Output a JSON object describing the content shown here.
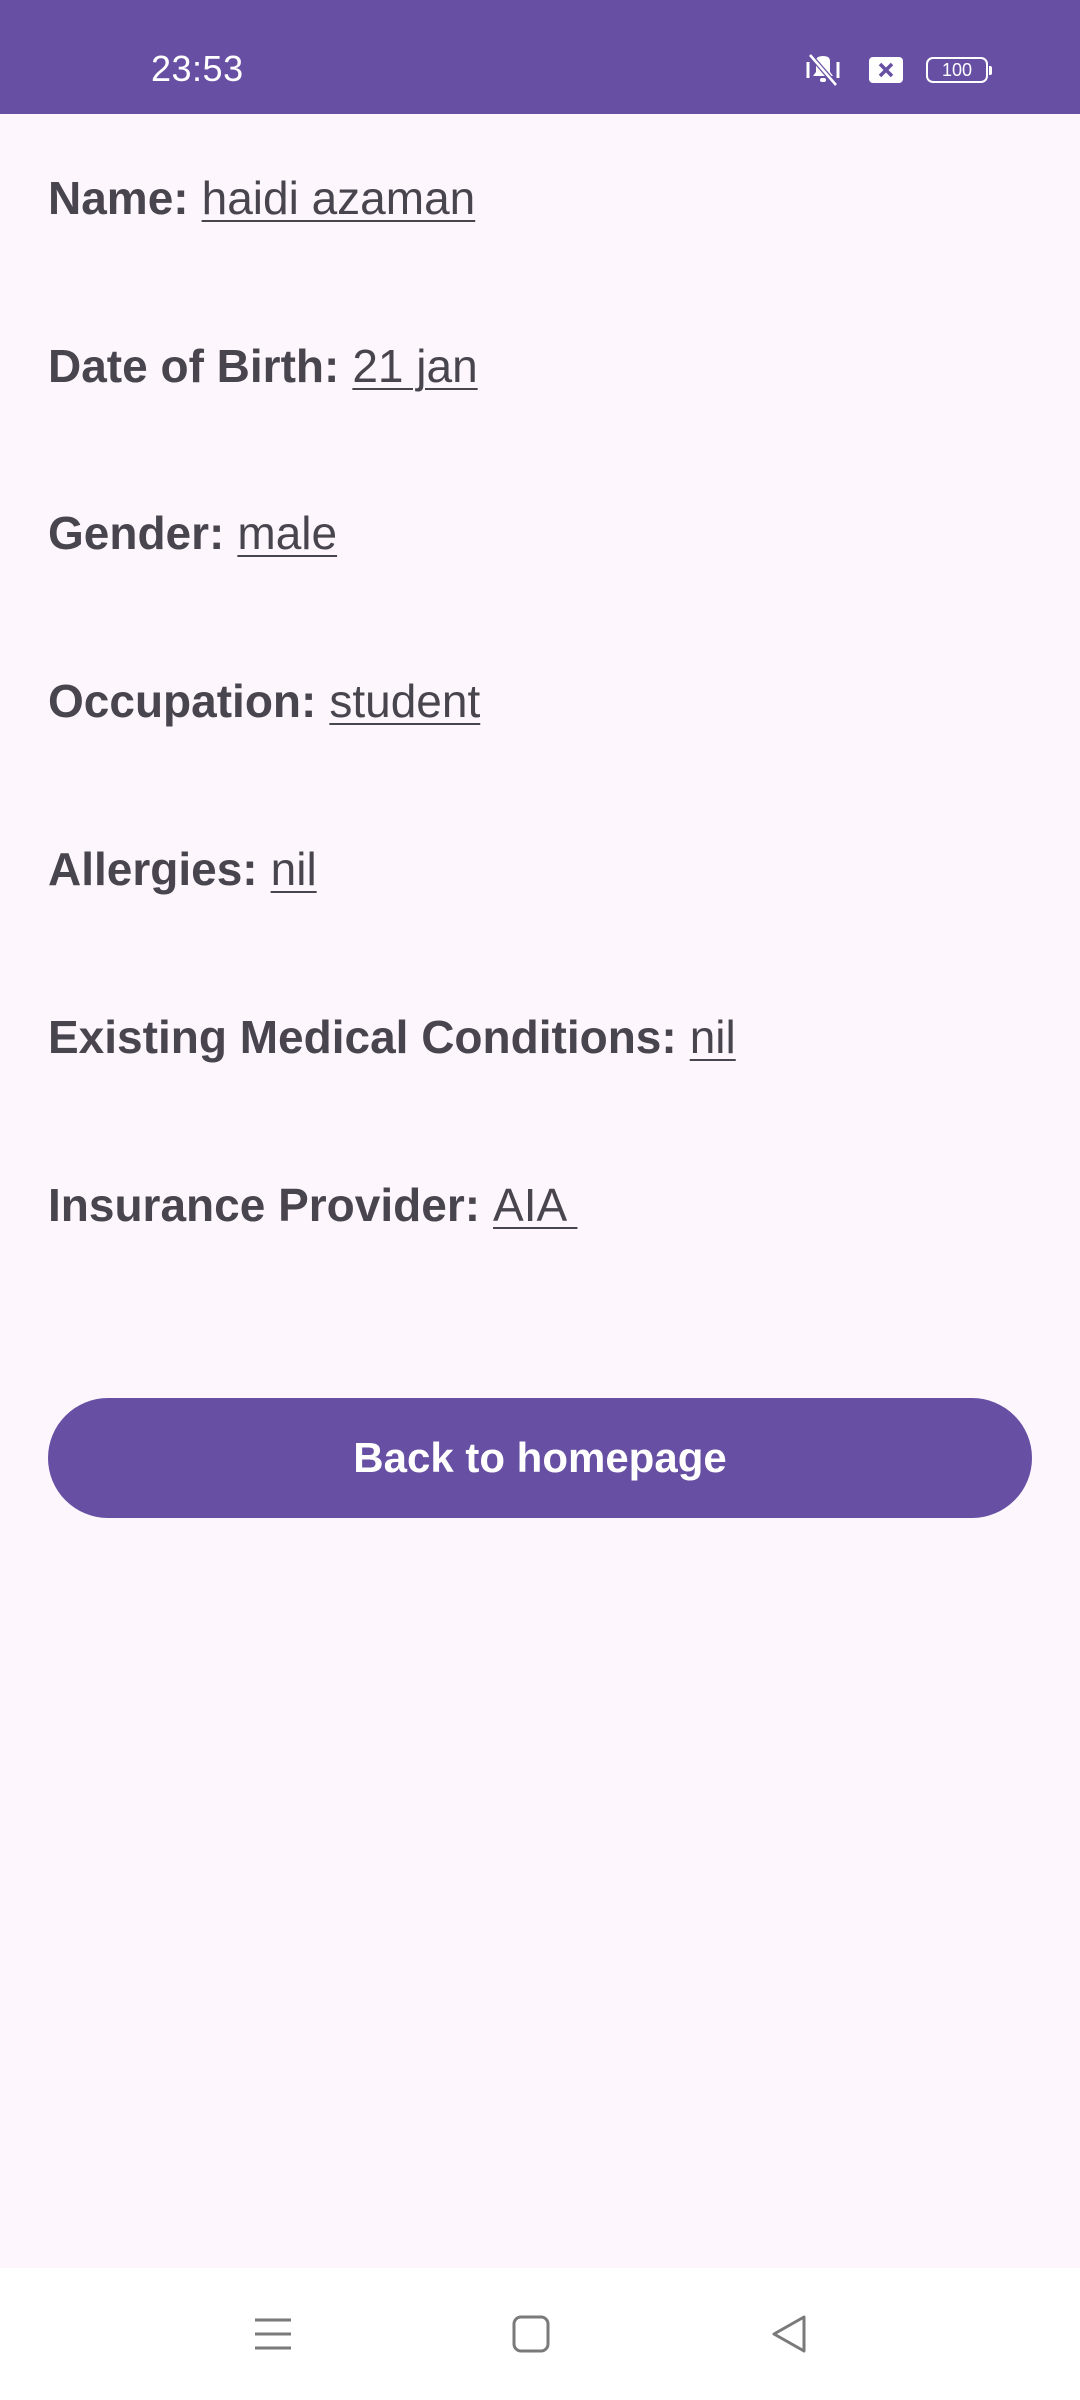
{
  "status_bar": {
    "time": "23:53",
    "battery": "100",
    "icons": [
      "vibrate-mute-icon",
      "notification-x-icon",
      "battery-icon"
    ]
  },
  "profile": {
    "fields": [
      {
        "label": "Name:",
        "value": "haidi azaman"
      },
      {
        "label": "Date of Birth:",
        "value": "21 jan"
      },
      {
        "label": "Gender:",
        "value": "male"
      },
      {
        "label": "Occupation:",
        "value": "student"
      },
      {
        "label": "Allergies:",
        "value": "nil"
      },
      {
        "label": "Existing Medical Conditions:",
        "value": "nil"
      },
      {
        "label": "Insurance Provider:",
        "value": "AIA "
      }
    ]
  },
  "actions": {
    "back_label": "Back to homepage"
  },
  "nav": {
    "icons": [
      "menu-icon",
      "home-square-icon",
      "back-triangle-icon"
    ]
  },
  "colors": {
    "primary": "#6750a4",
    "background": "#fdf7fd",
    "text": "#49454f"
  }
}
